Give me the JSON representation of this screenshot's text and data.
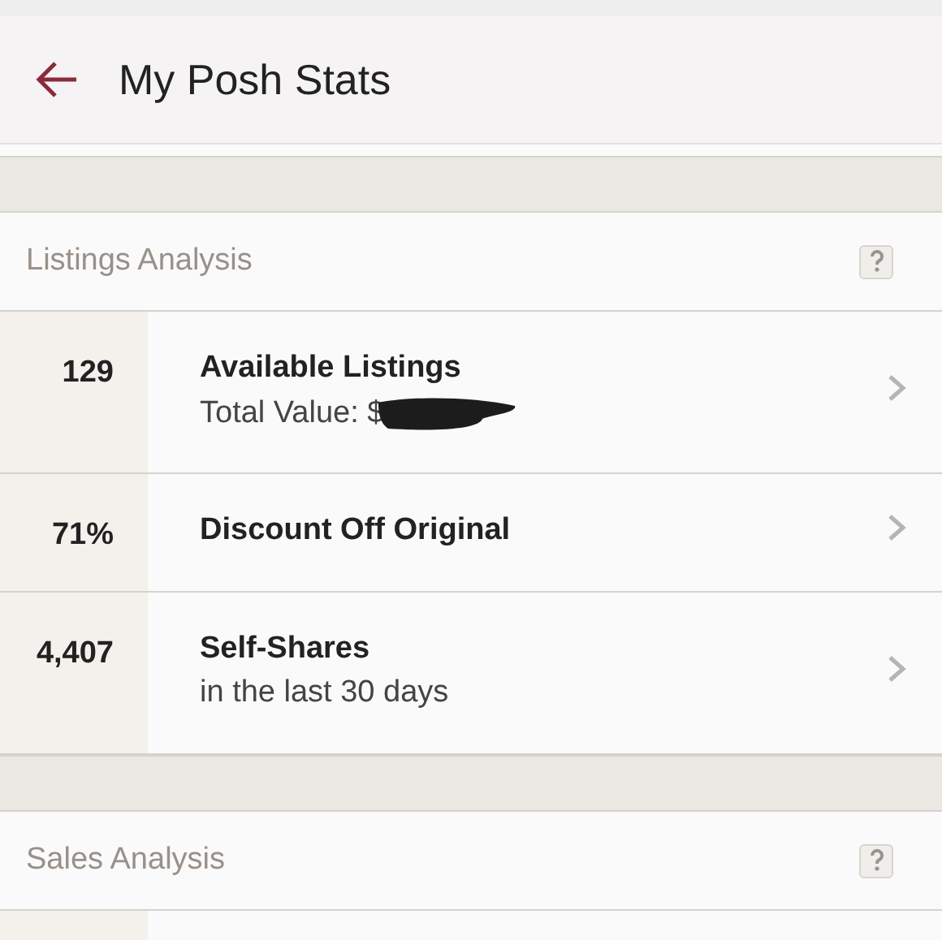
{
  "app_bar": {
    "title": "My Posh Stats"
  },
  "sections": [
    {
      "title": "Listings Analysis",
      "rows": [
        {
          "value": "129",
          "title": "Available Listings",
          "subtitle": "Total Value: $",
          "redacted": true
        },
        {
          "value": "71%",
          "title": "Discount Off Original"
        },
        {
          "value": "4,407",
          "title": "Self-Shares",
          "subtitle": "in the last 30 days"
        }
      ]
    },
    {
      "title": "Sales Analysis"
    }
  ]
}
